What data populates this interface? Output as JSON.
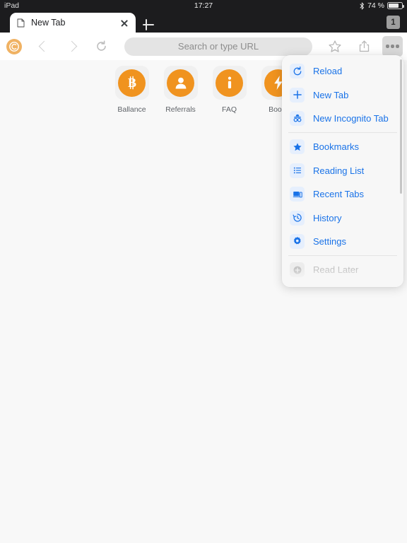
{
  "status_bar": {
    "device_label": "iPad",
    "time": "17:27",
    "battery_percent": "74 %",
    "bluetooth_icon": "bluetooth-icon"
  },
  "tab_strip": {
    "tabs": [
      {
        "title": "New Tab",
        "favicon": "page-icon",
        "close_icon": "close-icon"
      }
    ],
    "new_tab_icon": "plus-icon",
    "tab_count": "1"
  },
  "toolbar": {
    "logo_icon": "browser-logo-icon",
    "back_icon": "chevron-left-icon",
    "forward_icon": "chevron-right-icon",
    "reload_icon": "reload-icon",
    "omnibox_placeholder": "Search or type URL",
    "omnibox_value": "",
    "star_icon": "star-icon",
    "share_icon": "share-icon",
    "menu_icon": "overflow-menu-icon"
  },
  "shortcuts": [
    {
      "label": "Ballance",
      "icon": "bitcoin-icon"
    },
    {
      "label": "Referrals",
      "icon": "person-icon"
    },
    {
      "label": "FAQ",
      "icon": "info-icon"
    },
    {
      "label": "Boost",
      "icon": "lightning-bolt-icon"
    }
  ],
  "menu": {
    "groups": [
      {
        "items": [
          {
            "label": "Reload",
            "icon": "reload-icon",
            "disabled": false
          },
          {
            "label": "New Tab",
            "icon": "plus-icon",
            "disabled": false
          },
          {
            "label": "New Incognito Tab",
            "icon": "incognito-icon",
            "disabled": false
          }
        ]
      },
      {
        "items": [
          {
            "label": "Bookmarks",
            "icon": "star-filled-icon",
            "disabled": false
          },
          {
            "label": "Reading List",
            "icon": "list-icon",
            "disabled": false
          },
          {
            "label": "Recent Tabs",
            "icon": "devices-icon",
            "disabled": false
          },
          {
            "label": "History",
            "icon": "history-clock-icon",
            "disabled": false
          },
          {
            "label": "Settings",
            "icon": "gear-icon",
            "disabled": false
          }
        ]
      },
      {
        "items": [
          {
            "label": "Read Later",
            "icon": "plus-circle-icon",
            "disabled": true
          }
        ]
      }
    ]
  },
  "colors": {
    "accent_blue": "#1a73e8",
    "accent_orange": "#f0931f",
    "chrome_dark": "#1c1c1e",
    "page_background": "#f8f8f8"
  }
}
